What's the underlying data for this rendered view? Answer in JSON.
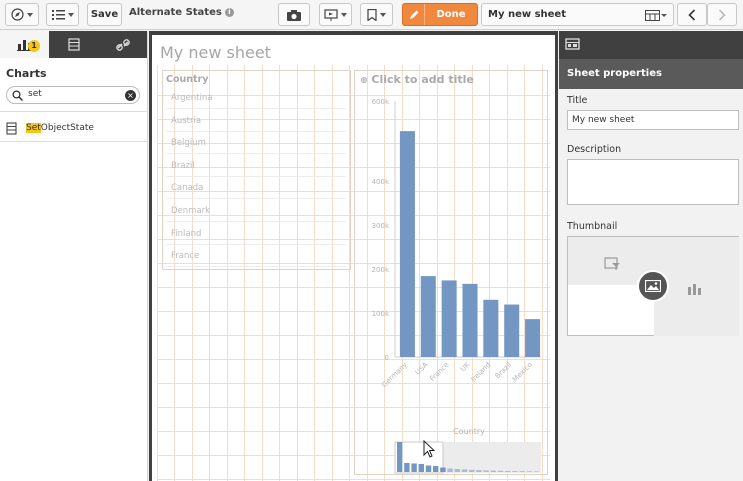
{
  "toolbar": {
    "save_label": "Save",
    "alternate_states_label": "Alternate States",
    "info_icon": "i",
    "done_label": "Done",
    "sheet_name": "My new sheet"
  },
  "left_panel": {
    "tabs": [
      "charts-tab",
      "master-items-tab",
      "links-tab"
    ],
    "charts_badge": "1",
    "section_title": "Charts",
    "search_value": "set",
    "result_highlight": "Set",
    "result_rest": "ObjectState"
  },
  "canvas": {
    "sheet_title": "My new sheet",
    "listbox": {
      "header": "Country",
      "items": [
        "Argentina",
        "Austria",
        "Belgium",
        "Brazil",
        "Canada",
        "Denmark",
        "Finland",
        "France"
      ]
    },
    "barchart_title": "Click to add title"
  },
  "chart_data": {
    "type": "bar",
    "title": "Click to add title",
    "xlabel": "",
    "ylabel": "",
    "categories": [
      "Germany",
      "USA",
      "France",
      "UK",
      "Ireland",
      "Brazil",
      "Mexico"
    ],
    "values": [
      525000,
      188000,
      178000,
      170000,
      133000,
      122000,
      88000
    ],
    "ylim": [
      0,
      600000
    ],
    "yticks": [
      "0",
      "100k",
      "200k",
      "300k",
      "400k",
      "600k"
    ],
    "yticks_top": "600k",
    "scrollbar_label": "Country",
    "color": "#7397c2"
  },
  "right_panel": {
    "header": "Sheet properties",
    "title_label": "Title",
    "title_value": "My new sheet",
    "description_label": "Description",
    "description_value": "",
    "thumbnail_label": "Thumbnail"
  },
  "colors": {
    "done": "#f0883e",
    "badge": "#f5c518",
    "bar": "#7397c2",
    "grid": "#f6dcc6"
  }
}
